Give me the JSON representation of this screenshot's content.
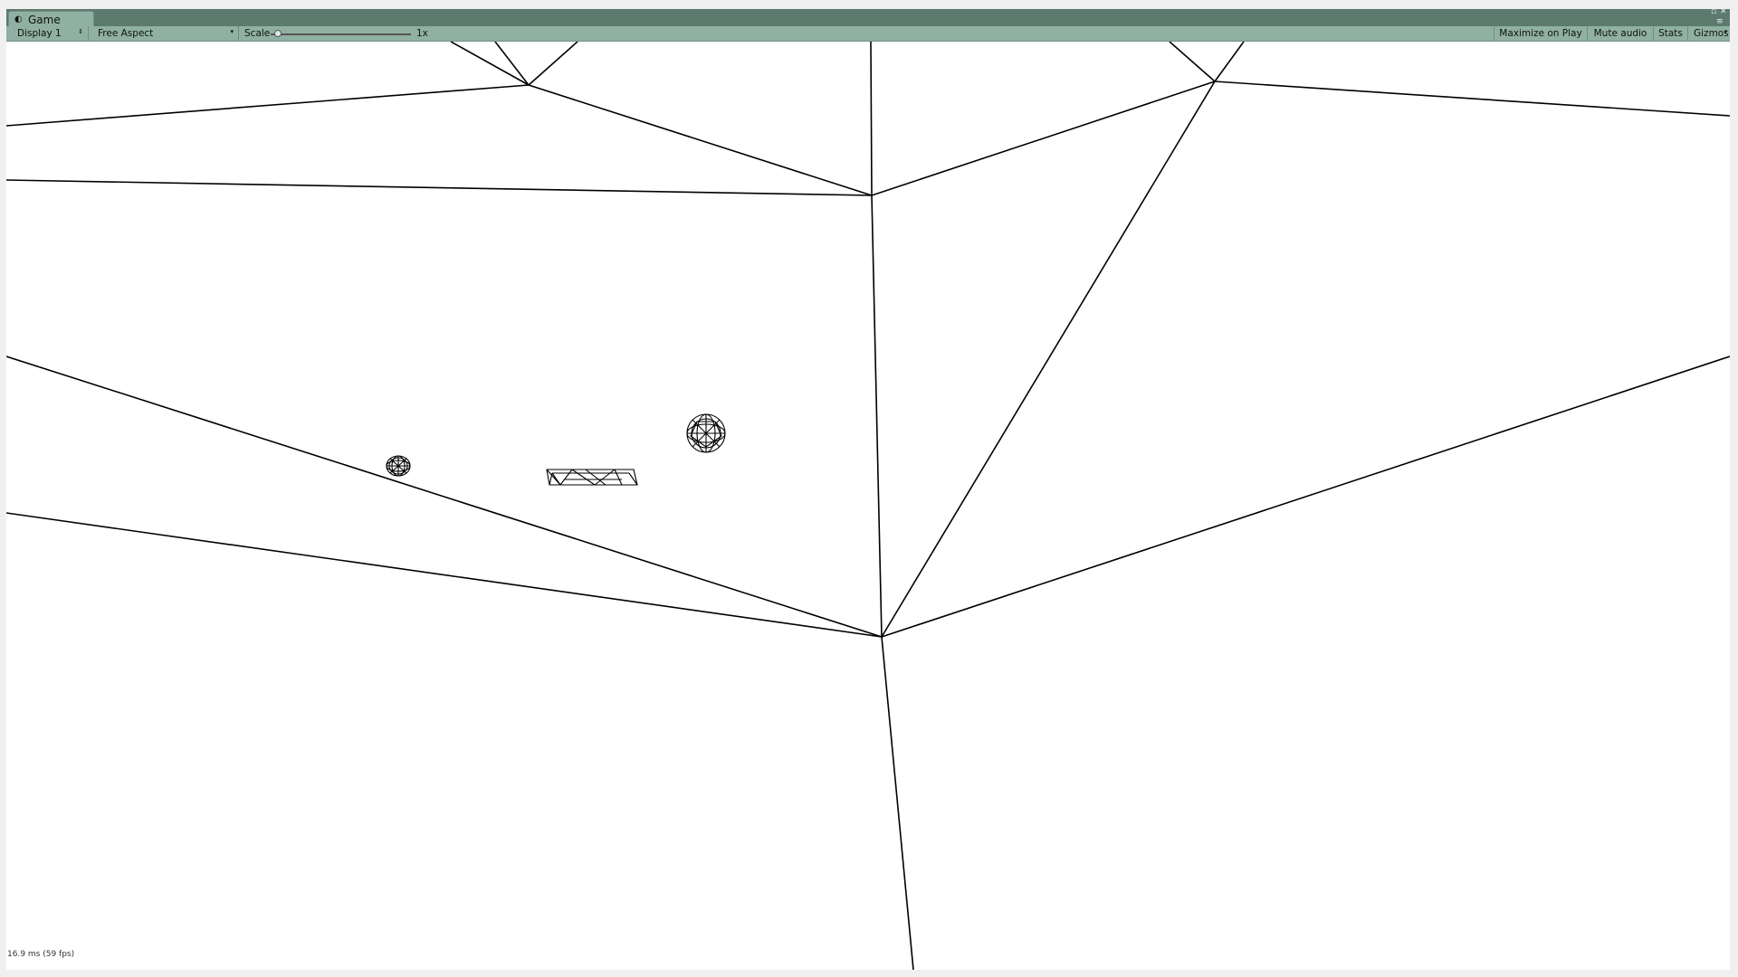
{
  "window": {
    "tab_label": "Game",
    "tab_icon": "unity-icon"
  },
  "toolbar": {
    "display": "Display 1",
    "aspect": "Free Aspect",
    "scale_label": "Scale",
    "scale_value": "1x",
    "scale_fraction": 0.0,
    "maximize_on_play": "Maximize on Play",
    "mute_audio": "Mute audio",
    "stats": "Stats",
    "gizmos": "Gizmos"
  },
  "viewport": {
    "fps": "16.9 ms (59 fps)"
  },
  "colors": {
    "titlebar": "#5d7a6f",
    "toolbar": "#8fb0a2",
    "viewport": "#ffffff",
    "wire": "#000000"
  }
}
